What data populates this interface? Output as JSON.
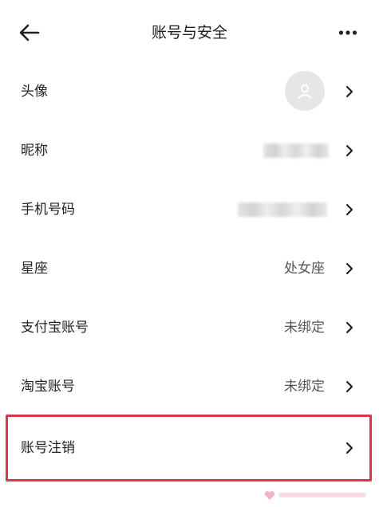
{
  "header": {
    "title": "账号与安全",
    "back_icon": "arrow-left-icon",
    "more_icon": "more-dots-icon"
  },
  "rows": [
    {
      "label": "头像",
      "value": "",
      "kind": "avatar"
    },
    {
      "label": "昵称",
      "value": "",
      "kind": "blurred"
    },
    {
      "label": "手机号码",
      "value": "",
      "kind": "blurred"
    },
    {
      "label": "星座",
      "value": "处女座",
      "kind": "text"
    },
    {
      "label": "支付宝账号",
      "value": "未绑定",
      "kind": "text"
    },
    {
      "label": "淘宝账号",
      "value": "未绑定",
      "kind": "text"
    },
    {
      "label": "账号注销",
      "value": "",
      "kind": "text"
    }
  ],
  "colors": {
    "highlight": "#e0324f",
    "chevron": "#222222",
    "avatar_bg": "#e6e6e6"
  }
}
